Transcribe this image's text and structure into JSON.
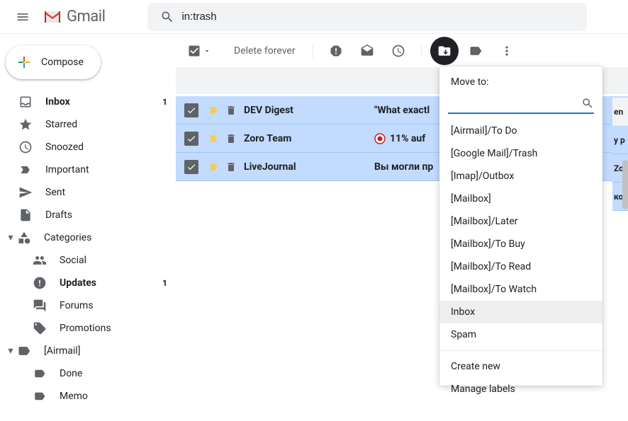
{
  "header": {
    "app_name": "Gmail",
    "search_value": "in:trash"
  },
  "compose_label": "Compose",
  "sidebar": {
    "items": [
      {
        "label": "Inbox",
        "count": "1",
        "bold": true,
        "icon": "inbox"
      },
      {
        "label": "Starred",
        "icon": "star"
      },
      {
        "label": "Snoozed",
        "icon": "clock"
      },
      {
        "label": "Important",
        "icon": "important"
      },
      {
        "label": "Sent",
        "icon": "sent"
      },
      {
        "label": "Drafts",
        "icon": "drafts"
      }
    ],
    "categories_label": "Categories",
    "categories": [
      {
        "label": "Social",
        "icon": "social"
      },
      {
        "label": "Updates",
        "count": "1",
        "bold": true,
        "icon": "updates"
      },
      {
        "label": "Forums",
        "icon": "forums"
      },
      {
        "label": "Promotions",
        "icon": "promotions"
      }
    ],
    "airmail_label": "[Airmail]",
    "airmail": [
      {
        "label": "Done"
      },
      {
        "label": "Memo"
      }
    ]
  },
  "toolbar": {
    "delete_forever": "Delete forever"
  },
  "messages": [
    {
      "sender": "DEV Digest",
      "subject": "\"What exactl"
    },
    {
      "sender": "Zoro Team",
      "subject": "11% auf ",
      "badge": true
    },
    {
      "sender": "LiveJournal",
      "subject": "Вы могли пр"
    }
  ],
  "right_strip": [
    "en",
    "y p",
    "Zor",
    "кот"
  ],
  "moveto": {
    "title": "Move to:",
    "items": [
      "[Airmail]/To Do",
      "[Google Mail]/Trash",
      "[Imap]/Outbox",
      "[Mailbox]",
      "[Mailbox]/Later",
      "[Mailbox]/To Buy",
      "[Mailbox]/To Read",
      "[Mailbox]/To Watch",
      "Inbox",
      "Spam"
    ],
    "highlighted_index": 8,
    "footer": [
      "Create new",
      "Manage labels"
    ]
  }
}
